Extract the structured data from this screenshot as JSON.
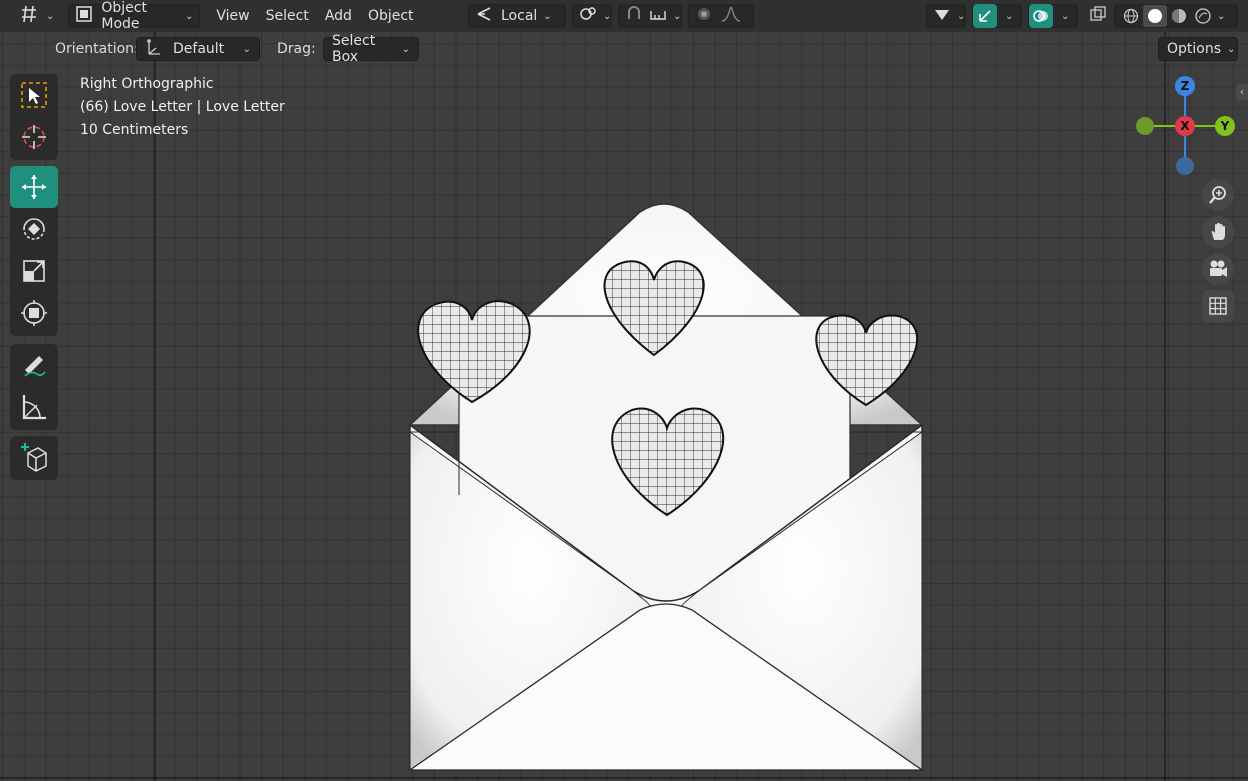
{
  "header": {
    "mode_label": "Object Mode",
    "menu": [
      "View",
      "Select",
      "Add",
      "Object"
    ],
    "transform_orientation": "Local",
    "options_label": "Options"
  },
  "toolsettings": {
    "orientation_label": "Orientation:",
    "orientation_value": "Default",
    "drag_label": "Drag:",
    "drag_value": "Select Box"
  },
  "viewport_info": {
    "view_name": "Right Orthographic",
    "object_line": "(66) Love Letter | Love Letter",
    "scale_line": "10 Centimeters"
  },
  "gizmo": {
    "z": "Z",
    "x": "X",
    "y": "Y"
  },
  "colors": {
    "header_bg": "#303030",
    "active_tool": "#1f8f7e",
    "axis_x": "#e03a48",
    "axis_y": "#83c11b",
    "axis_z": "#3b86e5"
  },
  "icons": [
    "editor-type-icon",
    "object-mode-icon",
    "pivot-icon",
    "snap-icon",
    "proportional-icon",
    "gizmo-icon",
    "overlay-icon",
    "xray-icon",
    "wireframe-shading-icon",
    "solid-shading-icon",
    "material-shading-icon",
    "rendered-shading-icon",
    "zoom-icon",
    "hand-pan-icon",
    "camera-icon",
    "grid-icon"
  ]
}
